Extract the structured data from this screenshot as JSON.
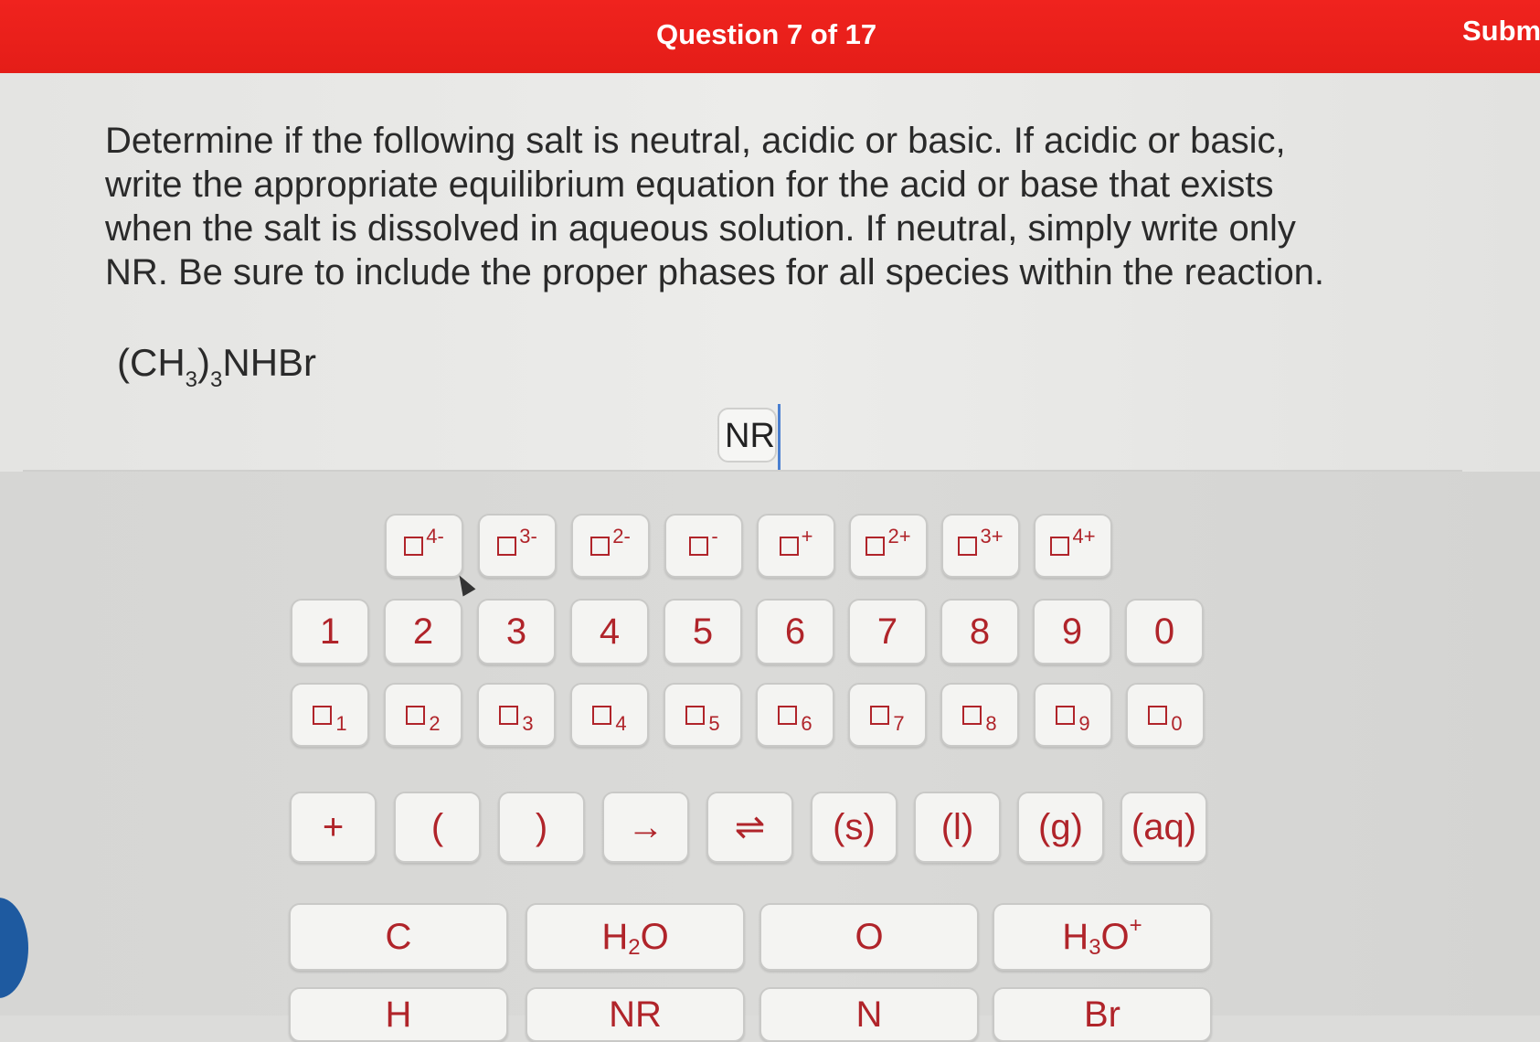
{
  "header": {
    "title": "Question 7 of 17",
    "submit_label": "Submit"
  },
  "question": {
    "lines": [
      "Determine if the following salt is neutral, acidic or basic. If acidic or basic,",
      "write the appropriate equilibrium equation for the acid or base that exists",
      "when the salt is dissolved in aqueous solution. If neutral, simply write only",
      "NR. Be sure to include the proper phases for all species within the reaction."
    ],
    "formula": {
      "open": "(CH",
      "sub1": "3",
      "close": ")",
      "sub2": "3",
      "rest": "NHBr"
    }
  },
  "answer": {
    "value": "NR"
  },
  "keypad": {
    "superscripts": [
      "4-",
      "3-",
      "2-",
      "-",
      "+",
      "2+",
      "3+",
      "4+"
    ],
    "digits": [
      "1",
      "2",
      "3",
      "4",
      "5",
      "6",
      "7",
      "8",
      "9",
      "0"
    ],
    "subscripts": [
      "1",
      "2",
      "3",
      "4",
      "5",
      "6",
      "7",
      "8",
      "9",
      "0"
    ],
    "symbols": [
      "+",
      "(",
      ")",
      "→",
      "⇌",
      "(s)",
      "(l)",
      "(g)",
      "(aq)"
    ],
    "chem": {
      "c": "C",
      "h2o": {
        "main": "H",
        "sub": "2",
        "tail": "O"
      },
      "o": "O",
      "h3o": {
        "main": "H",
        "sub": "3",
        "tail": "O",
        "sup": "+"
      }
    },
    "chem2": [
      "H",
      "NR",
      "N",
      "Br"
    ]
  },
  "colors": {
    "header": "#e41d18",
    "key_text": "#b0242a",
    "cursor": "#4a7fd0"
  }
}
